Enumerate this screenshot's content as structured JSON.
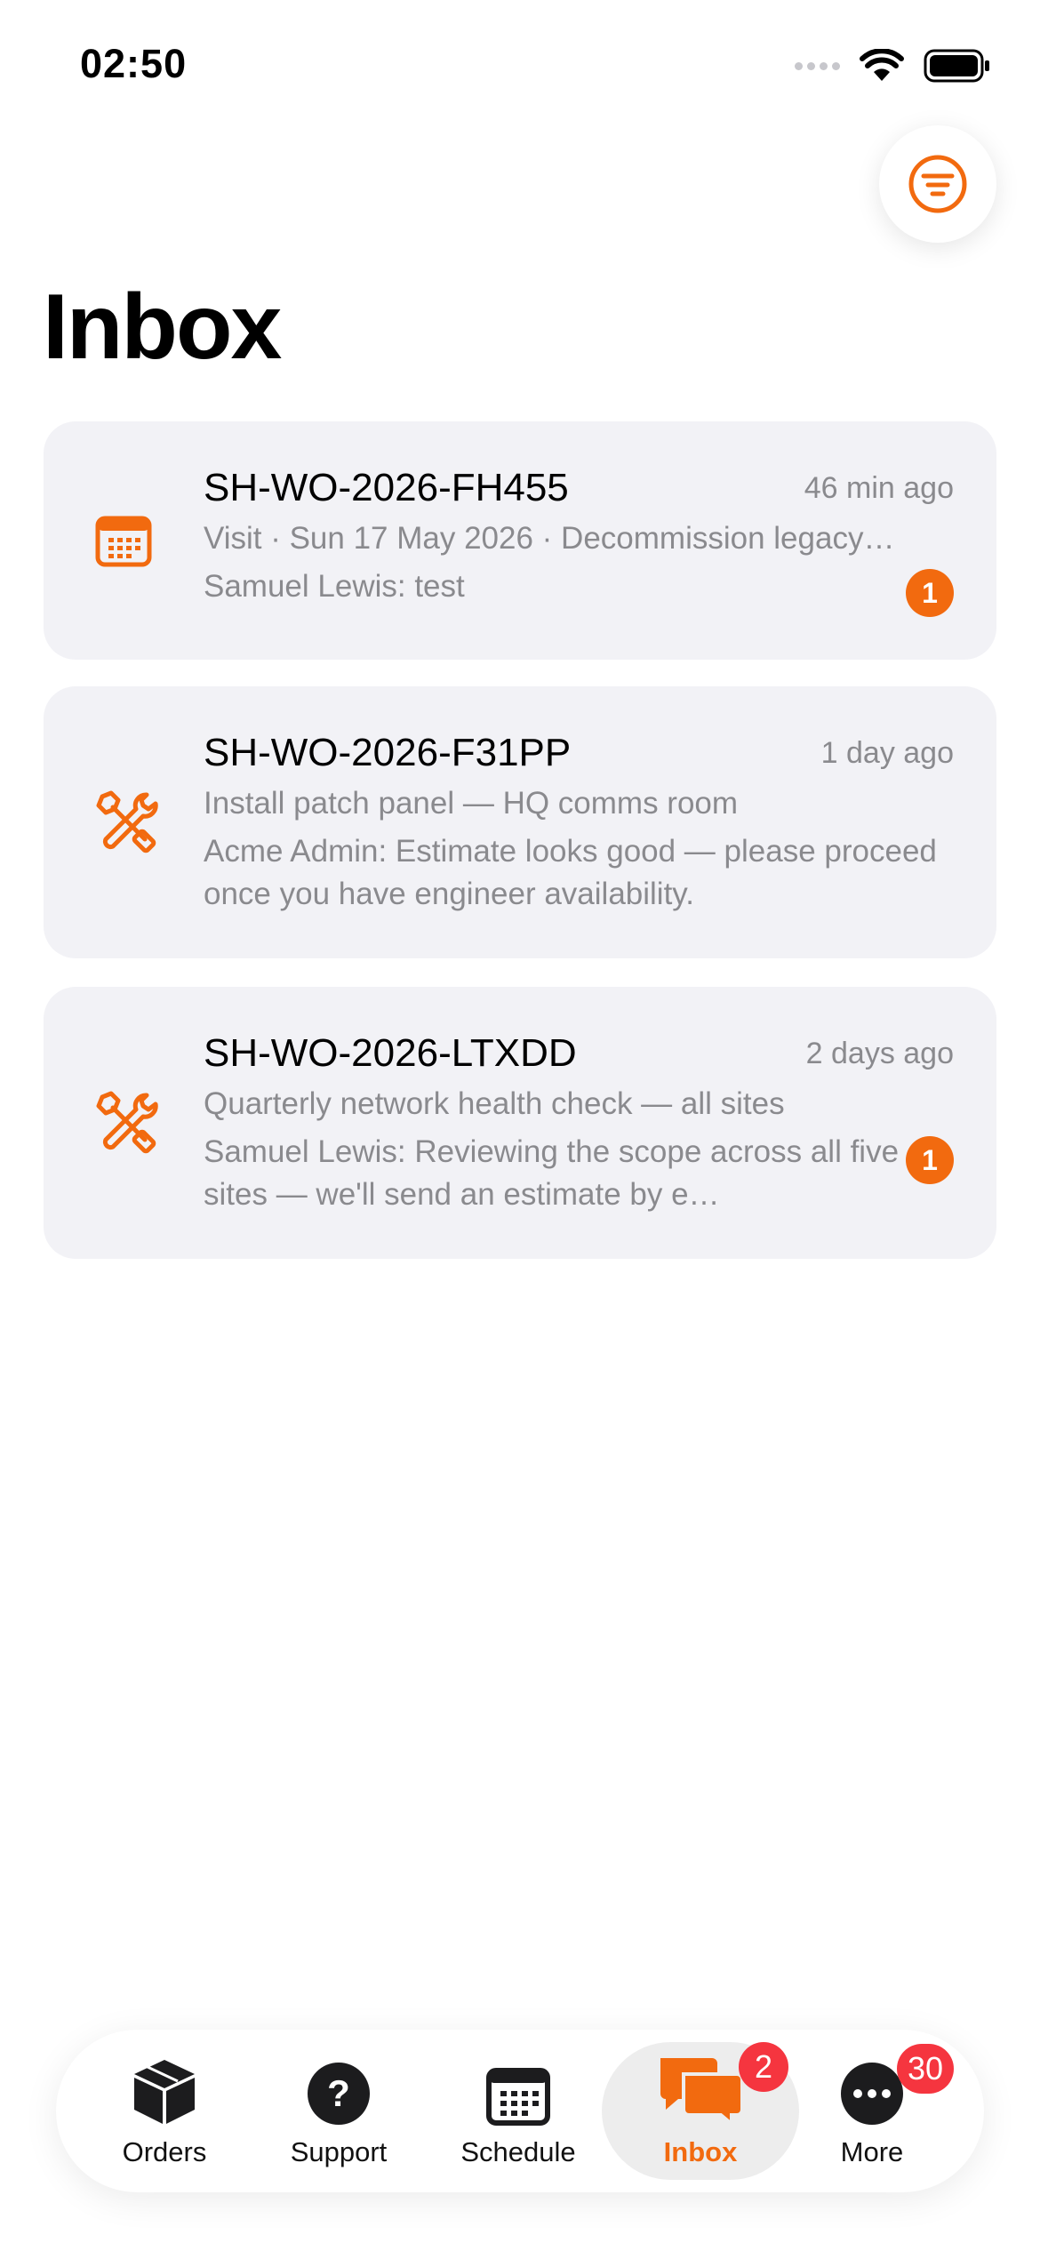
{
  "status_bar": {
    "time": "02:50"
  },
  "page": {
    "title": "Inbox"
  },
  "colors": {
    "accent": "#f26a0f",
    "badge_red": "#f5353f",
    "card_bg": "#f2f2f6"
  },
  "threads": [
    {
      "icon": "calendar-icon",
      "title": "SH-WO-2026-FH455",
      "time": "46 min ago",
      "subtitle": "Visit · Sun 17 May 2026 · Decommission legacy…",
      "message": "Samuel Lewis: test",
      "unread": "1"
    },
    {
      "icon": "tools-icon",
      "title": "SH-WO-2026-F31PP",
      "time": "1 day ago",
      "subtitle": "Install patch panel — HQ comms room",
      "message": "Acme Admin: Estimate looks good — please proceed once you have engineer availability."
    },
    {
      "icon": "tools-icon",
      "title": "SH-WO-2026-LTXDD",
      "time": "2 days ago",
      "subtitle": "Quarterly network health check — all sites",
      "message": "Samuel Lewis: Reviewing the scope across all five sites — we'll send an estimate by e…",
      "unread": "1"
    }
  ],
  "tabbar": {
    "orders": "Orders",
    "support": "Support",
    "schedule": "Schedule",
    "inbox": "Inbox",
    "inbox_badge": "2",
    "more": "More",
    "more_badge": "30"
  }
}
